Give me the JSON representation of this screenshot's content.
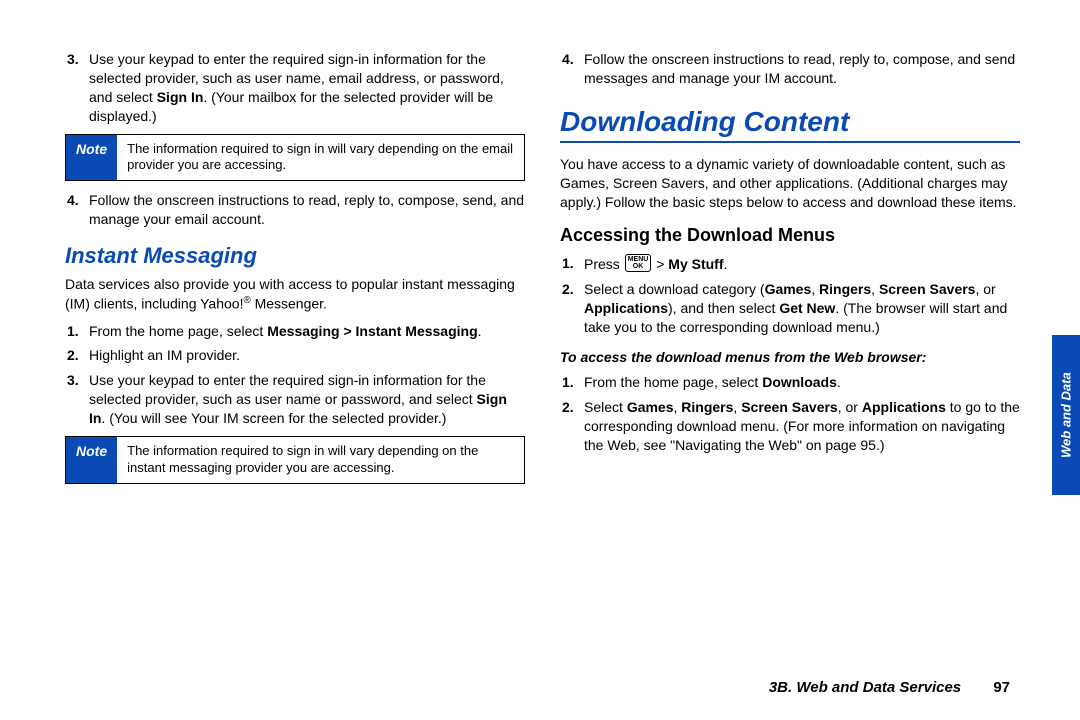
{
  "leftCol": {
    "item3": {
      "num": "3.",
      "text_a": "Use your keypad to enter the required sign-in information for the selected provider, such as user name, email address, or password, and select ",
      "bold_a": "Sign In",
      "text_b": ". (Your mailbox for the selected provider will be displayed.)"
    },
    "note1": {
      "label": "Note",
      "text": "The information required to sign in will vary depending on the email provider you are accessing."
    },
    "item4": {
      "num": "4.",
      "text": "Follow the onscreen instructions to read, reply to, compose, send, and manage your email account."
    },
    "heading_im": "Instant Messaging",
    "im_para_a": "Data services also provide you with access to popular instant messaging (IM) clients, including Yahoo!",
    "im_para_b": " Messenger.",
    "im1": {
      "num": "1.",
      "text_a": "From the home page, select ",
      "bold_a": "Messaging > Instant Messaging",
      "text_b": "."
    },
    "im2": {
      "num": "2.",
      "text": "Highlight an IM provider."
    },
    "im3": {
      "num": "3.",
      "text_a": "Use your keypad to enter the required sign-in information for the selected provider, such as user name or password, and select ",
      "bold_a": "Sign In",
      "text_b": ". (You will see Your IM screen for the selected provider.)"
    },
    "note2": {
      "label": "Note",
      "text": "The information required to sign in will vary depending on the instant messaging provider you are accessing."
    }
  },
  "rightCol": {
    "item4": {
      "num": "4.",
      "text": "Follow the onscreen instructions to read, reply to, compose, and send messages and manage your IM account."
    },
    "heading_dl": "Downloading Content",
    "dl_para": "You have access to a dynamic variety of downloadable content, such as Games, Screen Savers, and other applications. (Additional charges may apply.) Follow the basic steps below to access and download these items.",
    "heading_access": "Accessing the Download Menus",
    "acc1": {
      "num": "1.",
      "text_a": "Press ",
      "key_top": "MENU",
      "key_bot": "OK",
      "text_b": " > ",
      "bold_a": "My Stuff",
      "text_c": "."
    },
    "acc2": {
      "num": "2.",
      "text_a": "Select a download category (",
      "bold_a": "Games",
      "sep1": ", ",
      "bold_b": "Ringers",
      "sep2": ", ",
      "bold_c": "Screen Savers",
      "sep3": ", or ",
      "bold_d": "Applications",
      "text_b": "), and then select ",
      "bold_e": "Get New",
      "text_c": ". (The browser will start and take you to the corresponding download menu.)"
    },
    "subhead": "To access the download menus from the Web browser:",
    "web1": {
      "num": "1.",
      "text_a": "From the home page, select ",
      "bold_a": "Downloads",
      "text_b": "."
    },
    "web2": {
      "num": "2.",
      "text_a": "Select ",
      "bold_a": "Games",
      "sep1": ", ",
      "bold_b": "Ringers",
      "sep2": ", ",
      "bold_c": "Screen Savers",
      "sep3": ", or ",
      "bold_d": "Applications",
      "text_b": " to go to the corresponding download menu. (For more information on navigating the Web, see \"Navigating the Web\" on page 95.)"
    }
  },
  "sideTab": "Web and Data",
  "footer": {
    "section": "3B. Web and Data Services",
    "page": "97"
  }
}
